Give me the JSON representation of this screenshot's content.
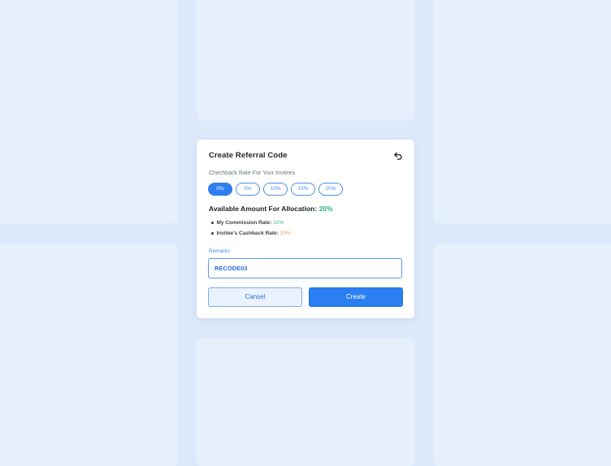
{
  "modal": {
    "title": "Create Referral Code",
    "back_icon": "undo-arrow-icon",
    "rate_label": "Chechback Rate For Your Invitees",
    "rates": [
      "0%",
      "5%",
      "10%",
      "15%",
      "20%"
    ],
    "selected_rate": "0%",
    "available_label": "Available Amount For Allocation:",
    "available_value": "20%",
    "commission_label": "My Commission Rate:",
    "commission_value": "10%",
    "cashback_label": "Invitee's Cashback Rate:",
    "cashback_value": "10%",
    "remarks_label": "Remarks",
    "remarks_value": "RECODE03",
    "cancel_label": "Cansel",
    "create_label": "Create"
  },
  "colors": {
    "background": "#dce9fb",
    "accent": "#2b7ff2",
    "green": "#22b573",
    "orange": "#f0a24a"
  }
}
